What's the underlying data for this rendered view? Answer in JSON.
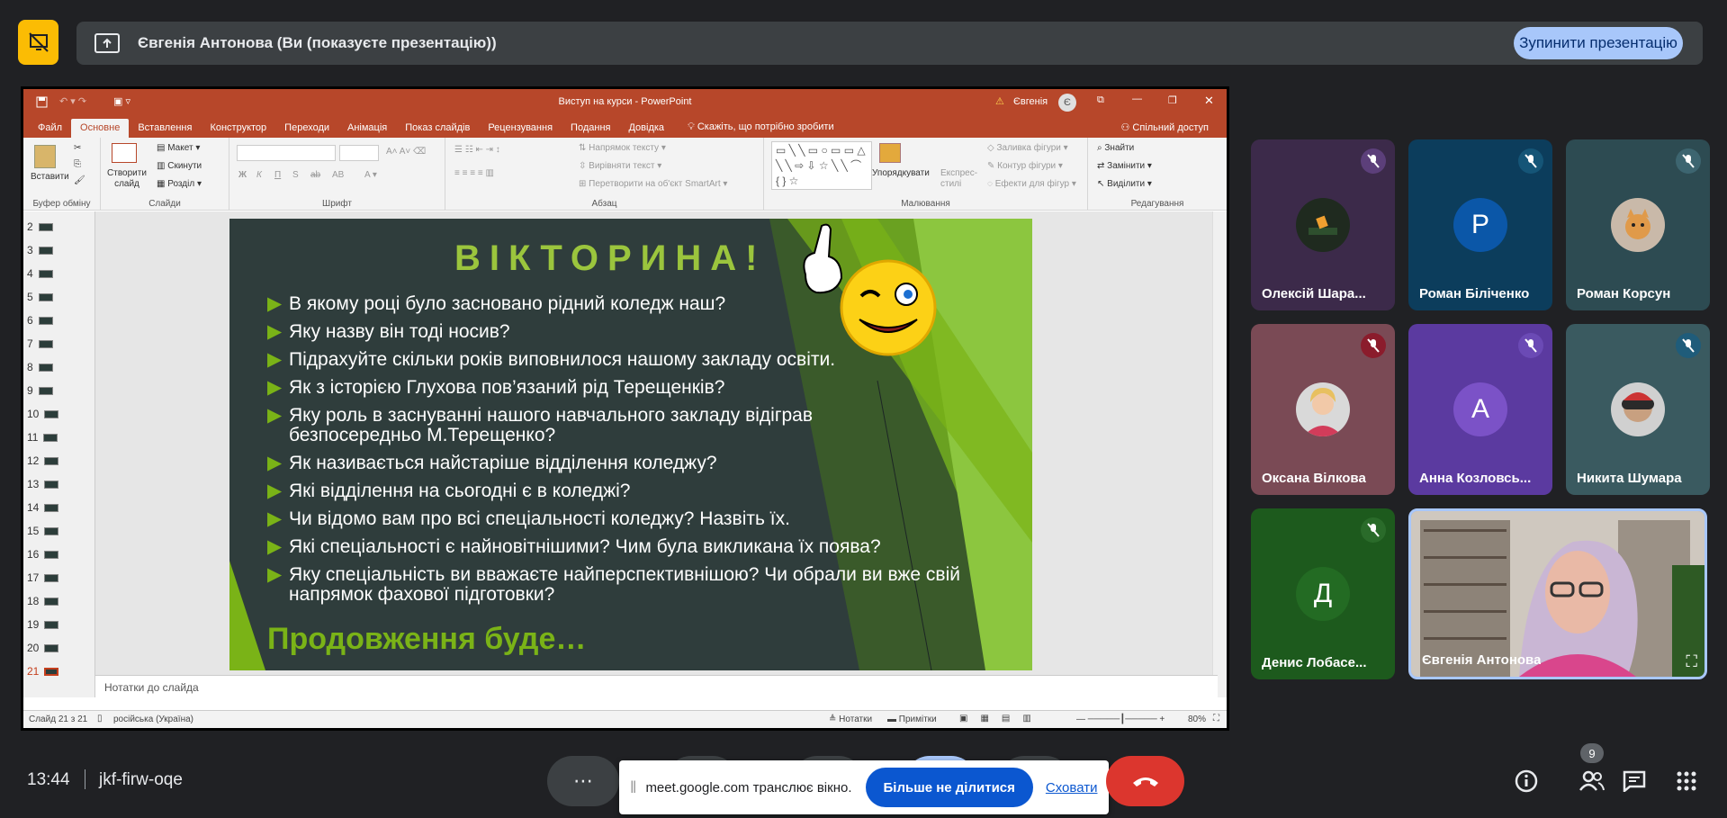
{
  "top_bar": {
    "presenter_text": "Євгенія Антонова (Ви (показуєте презентацію))",
    "stop_button": "Зупинити презентацію"
  },
  "powerpoint": {
    "window_title": "Виступ на курси  -  PowerPoint",
    "warning_user": "Євгенія",
    "user_initial": "Є",
    "tabs": [
      "Файл",
      "Основне",
      "Вставлення",
      "Конструктор",
      "Переходи",
      "Анімація",
      "Показ слайдів",
      "Рецензування",
      "Подання",
      "Довідка"
    ],
    "tell_me": "Скажіть, що потрібно зробити",
    "share": "Спільний доступ",
    "ribbon": {
      "paste": "Вставити",
      "clipboard": "Буфер обміну",
      "new_slide": "Створити слайд",
      "layout": "Макет",
      "reset": "Скинути",
      "section": "Розділ",
      "slides": "Слайди",
      "font": "Шрифт",
      "font_buttons": [
        "Ж",
        "К",
        "П",
        "S",
        "аb",
        "АВ"
      ],
      "text_direction": "Напрямок тексту",
      "align_text": "Вирівняти текст",
      "smartart": "Перетворити на об'єкт SmartArt",
      "paragraph": "Абзац",
      "arrange": "Упорядкувати",
      "quick_styles": "Експрес-стилі",
      "shape_fill": "Заливка фігури",
      "shape_outline": "Контур фігури",
      "shape_effects": "Ефекти для фігур",
      "drawing": "Малювання",
      "find": "Знайти",
      "replace": "Замінити",
      "select": "Виділити",
      "editing": "Редагування"
    },
    "thumbnails": [
      "2",
      "3",
      "4",
      "5",
      "6",
      "7",
      "8",
      "9",
      "10",
      "11",
      "12",
      "13",
      "14",
      "15",
      "16",
      "17",
      "18",
      "19",
      "20",
      "21"
    ],
    "notes_placeholder": "Нотатки до слайда",
    "status": {
      "slide_count": "Слайд 21 з 21",
      "language": "російська (Україна)",
      "notes": "Нотатки",
      "comments": "Примітки",
      "zoom": "80%"
    }
  },
  "slide": {
    "title": "ВІКТОРИНА!",
    "bullets": [
      "В якому році було засновано рідний коледж наш?",
      "Яку назву він тоді носив?",
      "Підрахуйте скільки років виповнилося нашому закладу освіти.",
      "Як з історією Глухова пов’язаний рід Терещенків?",
      "Яку роль в заснуванні нашого навчального закладу відіграв безпосередньо М.Терещенко?",
      "Як називається найстаріше відділення коледжу?",
      "Які відділення на сьогодні є в коледжі?",
      "Чи відомо вам про всі спеціальності коледжу? Назвіть їх.",
      "Які спеціальності є найновітнішими? Чим була викликана їх поява?",
      "Яку спеціальність ви вважаєте найперспективнішою? Чи обрали ви вже свій напрямок фахової підготовки?"
    ],
    "footer": "Продовження буде…",
    "colors": {
      "bg": "#2f3d3c",
      "title": "#9bc53d",
      "accent": "#7ab317"
    }
  },
  "participants": [
    {
      "name": "Олексій Шара...",
      "initial": "",
      "bg": "#3c2a4a"
    },
    {
      "name": "Роман Біліченко",
      "initial": "P",
      "bg": "#0c3d5c"
    },
    {
      "name": "Роман Корсун",
      "initial": "",
      "bg": "#2d4b52"
    },
    {
      "name": "Оксана Вілкова",
      "initial": "",
      "bg": "#7a4a55"
    },
    {
      "name": "Анна Козловсь...",
      "initial": "A",
      "bg": "#5b3aa0"
    },
    {
      "name": "Никита Шумара",
      "initial": "",
      "bg": "#3a5a60"
    },
    {
      "name": "Денис Лобасе...",
      "initial": "Д",
      "bg": "#1d5a1d"
    },
    {
      "name": "Євгенія Антонова",
      "initial": "",
      "bg": "#b0a79f"
    }
  ],
  "bottom_bar": {
    "time": "13:44",
    "meeting_code": "jkf-firw-oqe",
    "share_notice": "meet.google.com транслює вікно.",
    "stop_sharing": "Більше не ділитися",
    "hide": "Сховати",
    "participant_count": "9"
  }
}
